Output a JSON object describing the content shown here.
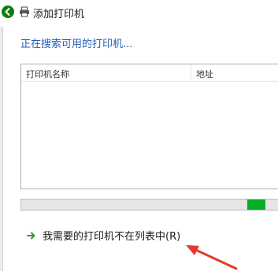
{
  "titlebar": {
    "title": "添加打印机"
  },
  "main": {
    "status": "正在搜索可用的打印机...",
    "list": {
      "columns": [
        "打印机名称",
        "地址"
      ],
      "rows": []
    },
    "progress": 0.07,
    "link_text": "我需要的打印机不在列表中(R)"
  },
  "icons": {
    "back": "back-arrow-icon",
    "printer": "printer-icon",
    "link": "green-arrow-icon",
    "annotation": "red-pointer-arrow"
  },
  "colors": {
    "back_button": "#107c10",
    "status_text": "#1f5fbf",
    "progress_fill": "#06b025",
    "link_arrow": "#2e9e2e",
    "annotation": "#e23b2a"
  }
}
